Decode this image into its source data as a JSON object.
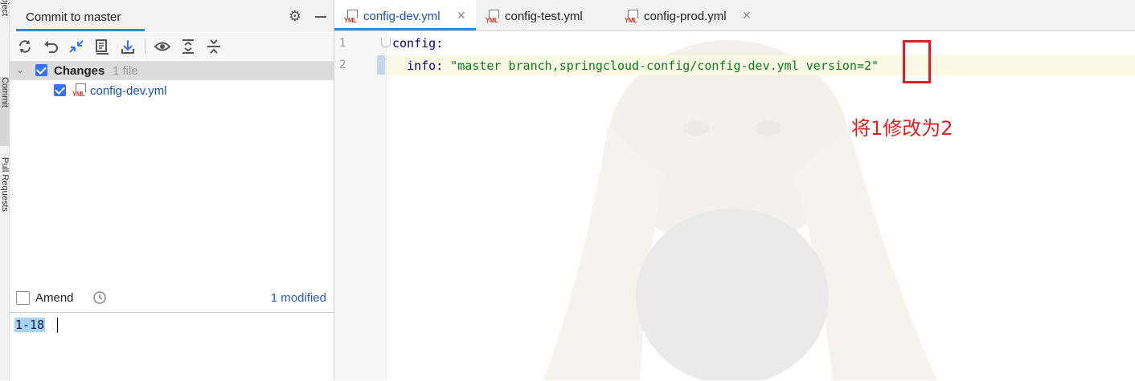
{
  "tool_stripe": {
    "project_label": "Project",
    "commit_label": "Commit",
    "pull_requests_label": "Pull Requests"
  },
  "commit_panel": {
    "title": "Commit to master",
    "toolbar_icons": [
      "refresh-icon",
      "rollback-icon",
      "show-diff-icon",
      "shelve-icon",
      "download-icon",
      "eye-icon",
      "expand-all-icon",
      "collapse-all-icon"
    ],
    "changes": {
      "label": "Changes",
      "count": "1 file",
      "checked": true,
      "files": [
        {
          "name": "config-dev.yml",
          "checked": true,
          "icon": "yml-file-icon"
        }
      ]
    },
    "amend": {
      "label": "Amend",
      "checked": false,
      "modified_link": "1 modified"
    },
    "message": {
      "text": "1-18"
    }
  },
  "editor": {
    "tabs": [
      {
        "name": "config-dev.yml",
        "active": true
      },
      {
        "name": "config-test.yml",
        "active": false
      },
      {
        "name": "config-prod.yml",
        "active": false
      }
    ],
    "line_numbers": [
      "1",
      "2"
    ],
    "lines": [
      {
        "key": "config",
        "colon": ":"
      },
      {
        "indent": "  ",
        "key": "info",
        "colon": ": ",
        "value": "\"master branch,springcloud-config/config-dev.yml version=2\""
      }
    ],
    "colors": {
      "key": "#000080",
      "string": "#067d17",
      "current_line": "#fbf9e6",
      "accent": "#4083c9"
    }
  },
  "annotation": {
    "text": "将1修改为2",
    "color": "#e02020"
  }
}
